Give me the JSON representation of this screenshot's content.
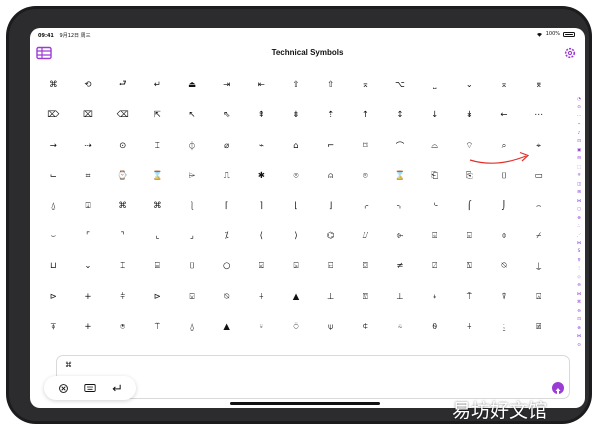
{
  "status": {
    "time": "09:41",
    "date": "9月12日 周三",
    "battery_text": "100%",
    "battery_level": 1.0
  },
  "app": {
    "title": "Technical Symbols",
    "accent": "#9b3bd6"
  },
  "icons": {
    "left": "grid-table-icon",
    "right": "gear-icon",
    "send": "send-icon"
  },
  "symbols": [
    "⌘",
    "⟲",
    "⮐",
    "↵",
    "⏏",
    "⇥",
    "⇤",
    "⇧",
    "⇧",
    "⌅",
    "⌥",
    "⎵",
    "⌄",
    "⌅",
    "⌆",
    "⌦",
    "⌧",
    "⌫",
    "⇱",
    "↖",
    "⇖",
    "⇞",
    "⇟",
    "⇡",
    "↑",
    "↕",
    "↓",
    "↡",
    "←",
    "⋯",
    "→",
    "⇢",
    "⊙",
    "⌶",
    "⏀",
    "⌀",
    "⌁",
    "⌂",
    "⌐",
    "⌑",
    "⌒",
    "⌓",
    "⌔",
    "⌕",
    "⌖",
    "⌙",
    "⌗",
    "⌚",
    "⌛",
    "⌲",
    "⎍",
    "✱",
    "⌾",
    "⍝",
    "⌾",
    "⌛",
    "⎗",
    "⎘",
    "⌷",
    "▭",
    "⍙",
    "⍗",
    "⌘",
    "⌘",
    "⎱",
    "⌈",
    "⌉",
    "⌊",
    "⌋",
    "⌌",
    "⌍",
    "⌎",
    "⌠",
    "⌡",
    "⌢",
    "⌣",
    "⌜",
    "⌝",
    "⌞",
    "⌟",
    "⁒",
    "⟨",
    "⟩",
    "⌬",
    "⌰",
    "⌱",
    "⌺",
    "⌻",
    "⌽",
    "⌿",
    "⊔",
    "⌄",
    "⌶",
    "⌸",
    "⌷",
    "○",
    "⍃",
    "⍄",
    "⍇",
    "⌼",
    "≠",
    "⍁",
    "⍂",
    "⍉",
    "⍊",
    "⊳",
    "+",
    "⫩",
    "⊳",
    "⍌",
    "⍉",
    "⍭",
    "▲",
    "⊥",
    "⍔",
    "⊥",
    "⍖",
    "⍑",
    "⍒",
    "⍓",
    "⍕",
    "+",
    "⍟",
    "⍡",
    "⍙",
    "▲",
    "⍤",
    "⍥",
    "⍦",
    "⍧",
    "⍨",
    "⍬",
    "⍭",
    "⍮",
    "⍯"
  ],
  "index_icons": [
    "◔",
    "⊙",
    "⋯",
    "⌁",
    "♪",
    "⊡",
    "▣",
    "⊟",
    "⬚",
    "⌾",
    "◫",
    "⊞",
    "⋈",
    "◻",
    "⊕",
    "∴",
    "⋰",
    "⋈",
    "S",
    "♀",
    "⋮",
    "◇",
    "⊖",
    "⋈",
    "⌘",
    "⊖",
    "⊡",
    "⊗",
    "⋈",
    "⊙"
  ],
  "input": {
    "value": "⌘"
  },
  "toolbar": {
    "icons": [
      "clear-icon",
      "keyboard-icon",
      "return-icon"
    ]
  },
  "watermark": "易坊好文馆"
}
